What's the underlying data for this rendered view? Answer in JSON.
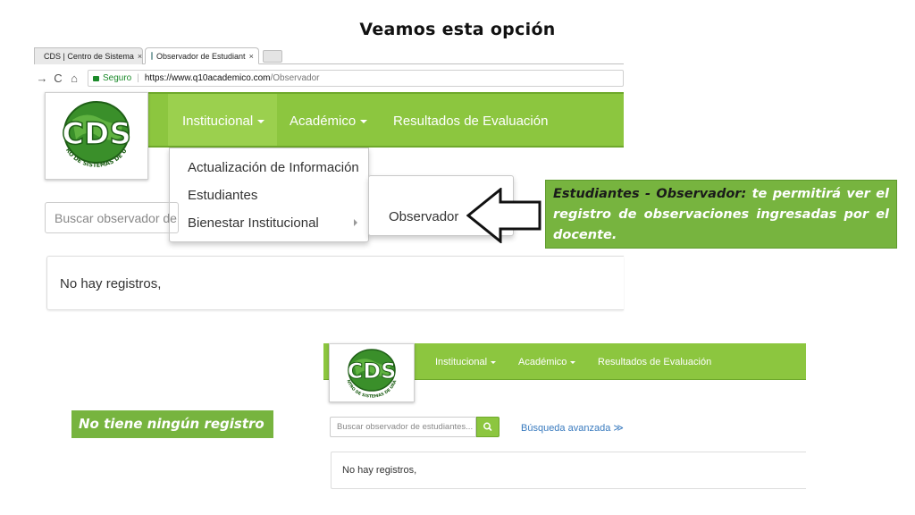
{
  "slide": {
    "title": "Veamos esta opción"
  },
  "browser": {
    "tabs": [
      {
        "label": "CDS | Centro de Sistema",
        "close": "×"
      },
      {
        "label": "Observador de Estudiant",
        "close": "×"
      }
    ],
    "secure_label": "Seguro",
    "url_host": "https://www.q10academico.com",
    "url_path": "/Observador"
  },
  "logo": {
    "text": "CDS",
    "ring_text": "CENTRO DE SISTEMAS DE URABA"
  },
  "nav": {
    "items": [
      "Institucional",
      "Académico",
      "Resultados de Evaluación"
    ]
  },
  "dropdown": {
    "items": [
      "Actualización de Información",
      "Estudiantes",
      "Bienestar Institucional"
    ],
    "submenu_item": "Observador"
  },
  "search": {
    "placeholder_partial": "Buscar observador de e",
    "placeholder": "Buscar observador de estudiantes...",
    "advanced": "Búsqueda avanzada ≫"
  },
  "results": {
    "empty": "No hay registros,"
  },
  "callout": {
    "strong": "Estudiantes - Observador:",
    "text": " te permitirá ver el registro de observaciones  ingresadas por el docente."
  },
  "note": {
    "text": "No tiene ningún registro"
  },
  "colors": {
    "brand_green": "#8cc63f",
    "callout_green": "#77b43f",
    "link_blue": "#3a7bbf"
  }
}
